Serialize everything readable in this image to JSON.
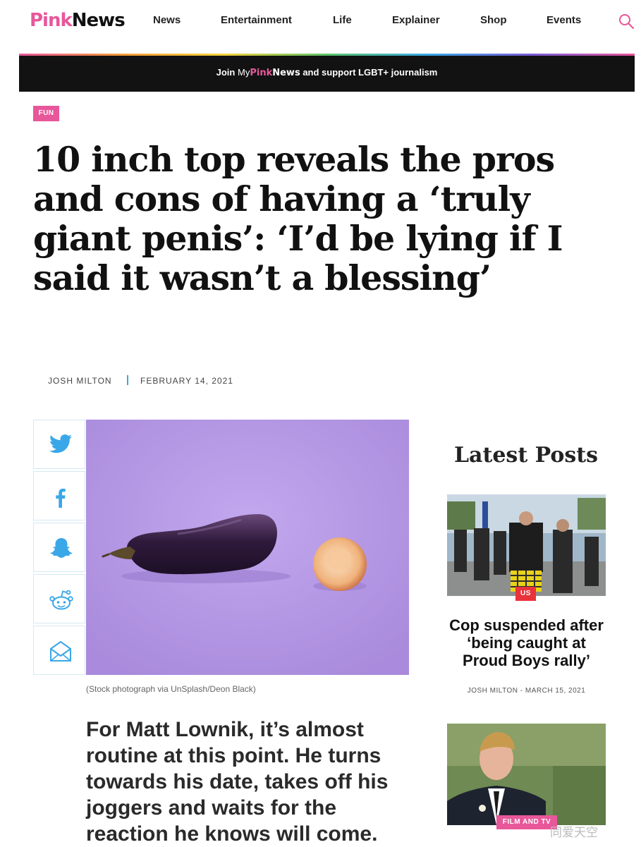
{
  "header": {
    "logo_pink": "Pink",
    "logo_news": "News",
    "nav": [
      "News",
      "Entertainment",
      "Life",
      "Explainer",
      "Shop",
      "Events"
    ]
  },
  "promo": {
    "join": "Join",
    "my": "My",
    "pink": "Pink",
    "news": "News",
    "rest": "and support LGBT+ journalism"
  },
  "article": {
    "tag": "FUN",
    "title": "10 inch top reveals the pros and cons of having a ‘truly giant penis’: ‘I’d be lying if I said it wasn’t a blessing’",
    "author": "JOSH MILTON",
    "date": "FEBRUARY 14, 2021",
    "caption": "(Stock photograph via UnSplash/Deon Black)",
    "lede": "For Matt Lownik, it’s almost routine at this point. He turns towards his date, takes off his joggers and waits for the reaction he knows will come."
  },
  "share": [
    "twitter-icon",
    "facebook-icon",
    "snapchat-icon",
    "reddit-icon",
    "email-icon"
  ],
  "sidebar": {
    "heading": "Latest Posts",
    "posts": [
      {
        "badge": "US",
        "title": "Cop suspended after ‘being caught at Proud Boys rally’",
        "meta": "JOSH MILTON - MARCH 15, 2021"
      },
      {
        "badge": "FILM AND TV"
      }
    ]
  },
  "watermark": "同爱天空",
  "colors": {
    "brand_pink": "#e8579a",
    "badge_red": "#e8333a",
    "promo_bg": "#121212",
    "share_blue": "#3aa7e8"
  }
}
